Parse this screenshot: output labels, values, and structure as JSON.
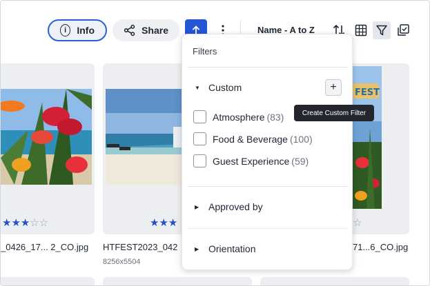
{
  "toolbar": {
    "info_label": "Info",
    "share_label": "Share",
    "sort_label": "Name - A to Z",
    "icons": {
      "info": "info-circle-icon",
      "share": "share-icon",
      "upload": "upload-arrow-icon",
      "more": "more-vertical-icon",
      "sort_direction": "sort-direction-icon",
      "grid": "grid-icon",
      "filter": "filter-icon",
      "select": "multi-select-icon"
    }
  },
  "gallery": {
    "cards": [
      {
        "filename": "_0426_17... 2_CO.jpg",
        "rating": 3,
        "max_rating": 5
      },
      {
        "filename": "HTFEST2023_042",
        "size": "8256x5504",
        "rating": 3,
        "max_rating": 5
      },
      {
        "filename": "71...6_CO.jpg",
        "rating": 0,
        "max_rating": 5
      }
    ]
  },
  "filters": {
    "title": "Filters",
    "sections": [
      {
        "label": "Custom",
        "expanded": true,
        "options": [
          {
            "label": "Atmosphere",
            "count": "(83)"
          },
          {
            "label": "Food & Beverage",
            "count": "(100)"
          },
          {
            "label": "Guest Experience",
            "count": "(59)"
          }
        ]
      },
      {
        "label": "Approved by",
        "expanded": false
      },
      {
        "label": "Orientation",
        "expanded": false
      }
    ],
    "tooltip": "Create Custom Filter"
  },
  "colors": {
    "accent": "#2656d6",
    "star": "#2450c8",
    "tooltip_bg": "#23272d"
  }
}
